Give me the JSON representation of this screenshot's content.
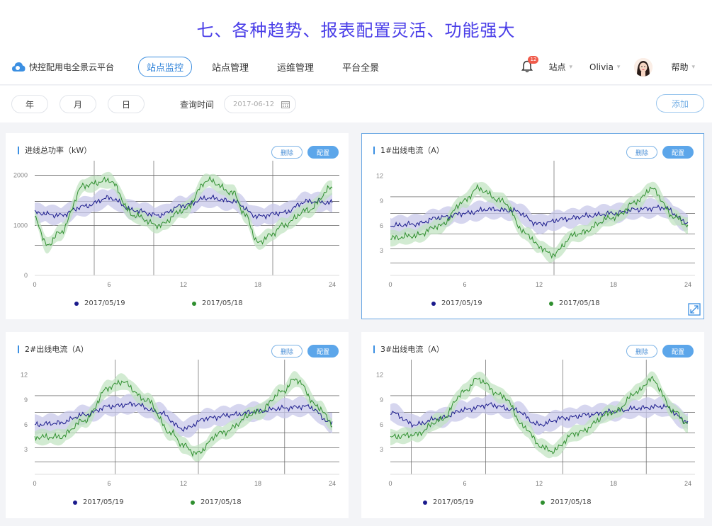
{
  "banner": {
    "title": "七、各种趋势、报表配置灵活、功能强大"
  },
  "header": {
    "app_name": "快控配用电全景云平台",
    "nav": [
      "站点监控",
      "站点管理",
      "运维管理",
      "平台全景"
    ],
    "active_nav": 0,
    "notification_count": "12",
    "site_label": "站点",
    "user_name": "Olivia",
    "help_label": "帮助"
  },
  "filters": {
    "year": "年",
    "month": "月",
    "day": "日",
    "query_label": "查询时间",
    "date_value": "2017-06-12",
    "add_label": "添加"
  },
  "colors": {
    "accent": "#3b8fe2",
    "series1": "#1a1a8c",
    "series2": "#2f8f2f",
    "band1": "#c8c8ea",
    "band2": "#bfe3bf"
  },
  "legend": {
    "s1": "2017/05/19",
    "s2": "2017/05/18"
  },
  "card_buttons": {
    "delete": "删除",
    "config": "配置"
  },
  "cards": [
    {
      "title": "进线总功率（kW）"
    },
    {
      "title": "1#出线电流（A）"
    },
    {
      "title": "2#出线电流（A）"
    },
    {
      "title": "3#出线电流（A）"
    }
  ],
  "chart_data": [
    {
      "type": "line",
      "title": "进线总功率（kW）",
      "x_ticks": [
        "0",
        "6",
        "12",
        "18",
        "24"
      ],
      "y_ticks": [
        "0",
        "1000",
        "2000"
      ],
      "ylim": [
        0,
        2150
      ],
      "xlim": [
        0,
        24
      ],
      "series": [
        {
          "name": "2017/05/19",
          "x": [
            0,
            2,
            4,
            6,
            8,
            10,
            12,
            14,
            16,
            18,
            20,
            22,
            24
          ],
          "y": [
            1250,
            1200,
            1380,
            1550,
            1300,
            1200,
            1400,
            1550,
            1480,
            1180,
            1250,
            1480,
            1450
          ]
        },
        {
          "name": "2017/05/18",
          "x": [
            0,
            1,
            2,
            4,
            6,
            8,
            10,
            12,
            14,
            16,
            17,
            18,
            19,
            20,
            22,
            24
          ],
          "y": [
            1150,
            600,
            850,
            1800,
            1900,
            1200,
            1000,
            1300,
            1900,
            1650,
            1200,
            650,
            800,
            1000,
            1300,
            1750
          ]
        }
      ]
    },
    {
      "type": "line",
      "title": "1#出线电流（A）",
      "x_ticks": [
        "0",
        "6",
        "12",
        "18",
        "24"
      ],
      "y_ticks": [
        "3",
        "6",
        "9",
        "12"
      ],
      "ylim": [
        0,
        13
      ],
      "xlim": [
        0,
        24
      ],
      "series": [
        {
          "name": "2017/05/19",
          "x": [
            0,
            2,
            4,
            6,
            8,
            10,
            12,
            14,
            16,
            18,
            20,
            22,
            24
          ],
          "y": [
            6,
            6.2,
            7,
            7.5,
            8,
            7.8,
            6.2,
            6.8,
            7.2,
            7.5,
            8,
            8.2,
            6.4
          ]
        },
        {
          "name": "2017/05/18",
          "x": [
            0,
            2,
            4,
            6,
            7,
            9,
            11,
            12,
            13,
            15,
            18,
            20,
            21,
            23,
            24
          ],
          "y": [
            4.5,
            4.8,
            6,
            9,
            10.5,
            9,
            5,
            3.5,
            2.5,
            5,
            7,
            9,
            10.5,
            7,
            6
          ]
        }
      ]
    },
    {
      "type": "line",
      "title": "2#出线电流（A）",
      "x_ticks": [
        "0",
        "6",
        "12",
        "18",
        "24"
      ],
      "y_ticks": [
        "3",
        "6",
        "9",
        "12"
      ],
      "ylim": [
        0,
        13
      ],
      "xlim": [
        0,
        24
      ],
      "series": [
        {
          "name": "2017/05/19",
          "x": [
            0,
            2,
            4,
            6,
            8,
            10,
            12,
            14,
            16,
            18,
            20,
            22,
            24
          ],
          "y": [
            6,
            6.2,
            7.2,
            8.2,
            8.5,
            7.5,
            5.5,
            6.8,
            7.2,
            7.6,
            8,
            8.2,
            6.2
          ]
        },
        {
          "name": "2017/05/18",
          "x": [
            0,
            2,
            4,
            6,
            7,
            9,
            11,
            12,
            13,
            15,
            18,
            20,
            21,
            23,
            24
          ],
          "y": [
            4.5,
            4.5,
            6.5,
            10.5,
            11.2,
            9,
            5,
            3.5,
            2.5,
            5,
            7.5,
            10,
            11.5,
            8,
            6
          ]
        }
      ]
    },
    {
      "type": "line",
      "title": "3#出线电流（A）",
      "x_ticks": [
        "0",
        "6",
        "12",
        "18",
        "24"
      ],
      "y_ticks": [
        "3",
        "6",
        "9",
        "12"
      ],
      "ylim": [
        0,
        13
      ],
      "xlim": [
        0,
        24
      ],
      "series": [
        {
          "name": "2017/05/19",
          "x": [
            0,
            2,
            4,
            6,
            8,
            10,
            12,
            14,
            16,
            18,
            20,
            22,
            24
          ],
          "y": [
            7.5,
            6,
            6.8,
            7.8,
            8.4,
            7.8,
            6,
            6.8,
            7.2,
            7.6,
            8,
            8.2,
            6.4
          ]
        },
        {
          "name": "2017/05/18",
          "x": [
            0,
            2,
            4,
            6,
            7,
            9,
            11,
            12,
            13,
            15,
            18,
            20,
            21,
            23,
            24
          ],
          "y": [
            4.5,
            4.8,
            6.5,
            10,
            11.5,
            9.5,
            5.5,
            3.5,
            2.8,
            5,
            7.5,
            10,
            11.5,
            7.5,
            6
          ]
        }
      ]
    }
  ]
}
